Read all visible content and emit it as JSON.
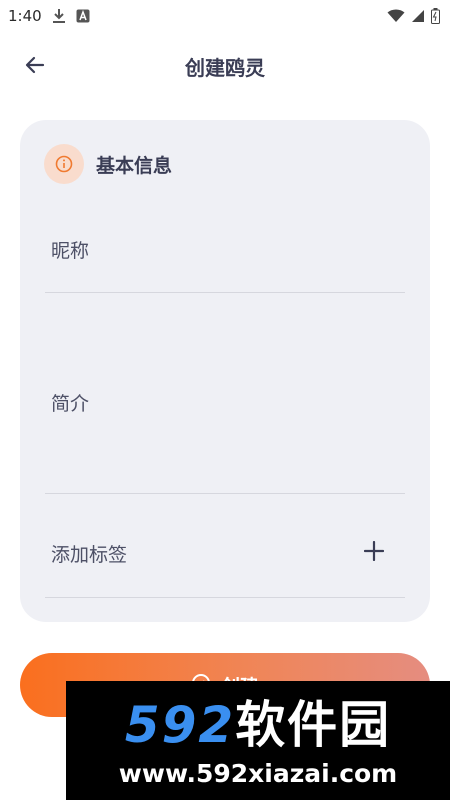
{
  "status_bar": {
    "time": "1:40",
    "icons": [
      "download-icon",
      "app-a-icon",
      "wifi-icon",
      "signal-icon",
      "battery-icon"
    ]
  },
  "header": {
    "title": "创建鸥灵",
    "back_icon": "arrow-left-icon"
  },
  "basic_info": {
    "section_title": "基本信息",
    "section_icon": "info-icon",
    "nickname_label": "昵称",
    "intro_label": "简介",
    "tags_label": "添加标签",
    "add_tag_icon": "plus-icon"
  },
  "actions": {
    "create_label": "创建",
    "create_icon": "create-icon"
  },
  "watermark": {
    "brand_number": "592",
    "brand_text": "软件园",
    "url": "www.592xiazai.com"
  },
  "colors": {
    "accent": "#fa6f1e",
    "accent_end": "#e58d80",
    "card_bg": "#eff0f5",
    "text": "#3a3d55",
    "info_badge_bg": "#f9dccd",
    "watermark_blue": "#3a8ff0"
  }
}
